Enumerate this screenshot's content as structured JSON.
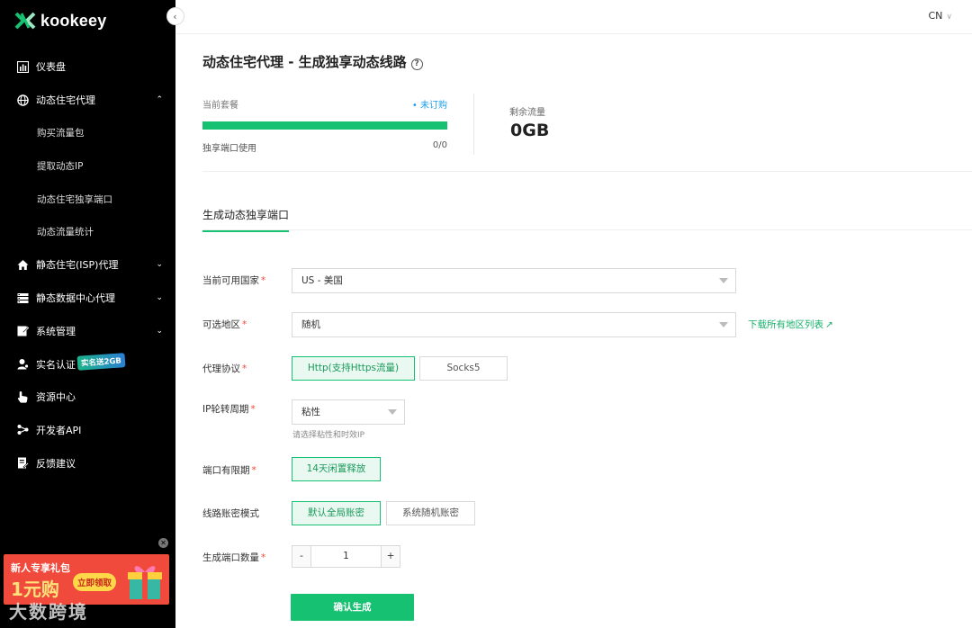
{
  "brand": {
    "name": "kookeey"
  },
  "topbar": {
    "lang": "CN"
  },
  "sidebar": {
    "items": [
      {
        "label": "仪表盘"
      },
      {
        "label": "动态住宅代理"
      },
      {
        "label": "购买流量包"
      },
      {
        "label": "提取动态IP"
      },
      {
        "label": "动态住宅独享端口"
      },
      {
        "label": "动态流量统计"
      },
      {
        "label": "静态住宅(ISP)代理"
      },
      {
        "label": "静态数据中心代理"
      },
      {
        "label": "系统管理"
      },
      {
        "label": "实名认证"
      },
      {
        "label": "资源中心"
      },
      {
        "label": "开发者API"
      },
      {
        "label": "反馈建议"
      }
    ],
    "badge": "实名送2GB",
    "promo": {
      "line1": "新人专享礼包",
      "line2": "1元购",
      "button": "立即领取"
    },
    "watermark": "大数跨境"
  },
  "page": {
    "title": "动态住宅代理 - 生成独享动态线路"
  },
  "stats": {
    "plan_label": "当前套餐",
    "plan_status": "• 未订购",
    "plan_progress": 1.0,
    "port_label": "独享端口使用",
    "port_value": "0/0",
    "remain_label": "剩余流量",
    "remain_value": "0GB"
  },
  "tab": {
    "label": "生成动态独享端口"
  },
  "form": {
    "country_label": "当前可用国家",
    "country_value": "US - 美国",
    "region_label": "可选地区",
    "region_value": "随机",
    "download_link": "下载所有地区列表",
    "protocol_label": "代理协议",
    "protocol_options": [
      "Http(支持Https流量)",
      "Socks5"
    ],
    "rotation_label": "IP轮转周期",
    "rotation_value": "粘性",
    "rotation_hint": "请选择粘性和时效IP",
    "expiry_label": "端口有限期",
    "expiry_option": "14天闲置释放",
    "account_label": "线路账密模式",
    "account_options": [
      "默认全局账密",
      "系统随机账密"
    ],
    "count_label": "生成端口数量",
    "count_minus": "-",
    "count_value": "1",
    "count_plus": "+",
    "submit": "确认生成"
  },
  "colors": {
    "accent": "#17c172",
    "sidebar_bg": "#000000",
    "link": "#1a9dea",
    "required": "#f04a3c"
  }
}
